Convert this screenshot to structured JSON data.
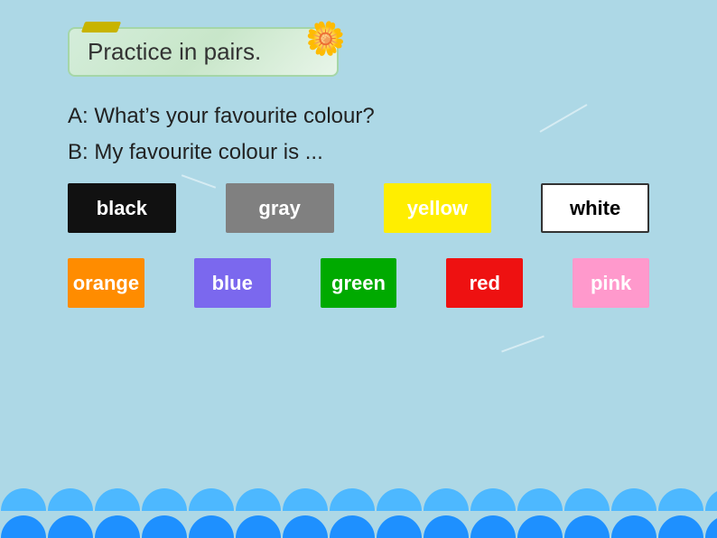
{
  "title": {
    "text": "Practice in pairs."
  },
  "questions": {
    "line_a": "A: What’s your favourite colour?",
    "line_b": "B: My favourite colour is ..."
  },
  "color_row1": [
    {
      "label": "black",
      "bg": "#111111",
      "text_color": "#ffffff",
      "border": false
    },
    {
      "label": "gray",
      "bg": "#808080",
      "text_color": "#ffffff",
      "border": false
    },
    {
      "label": "yellow",
      "bg": "#ffee00",
      "text_color": "#ffffff",
      "border": false
    },
    {
      "label": "white",
      "bg": "#ffffff",
      "text_color": "#000000",
      "border": true
    }
  ],
  "color_row2": [
    {
      "label": "orange",
      "bg": "#ff8c00",
      "text_color": "#ffffff",
      "border": false
    },
    {
      "label": "blue",
      "bg": "#7b68ee",
      "text_color": "#ffffff",
      "border": false
    },
    {
      "label": "green",
      "bg": "#00aa00",
      "text_color": "#ffffff",
      "border": false
    },
    {
      "label": "red",
      "bg": "#ee1111",
      "text_color": "#ffffff",
      "border": false
    },
    {
      "label": "pink",
      "bg": "#ff99cc",
      "text_color": "#ffffff",
      "border": false
    }
  ]
}
